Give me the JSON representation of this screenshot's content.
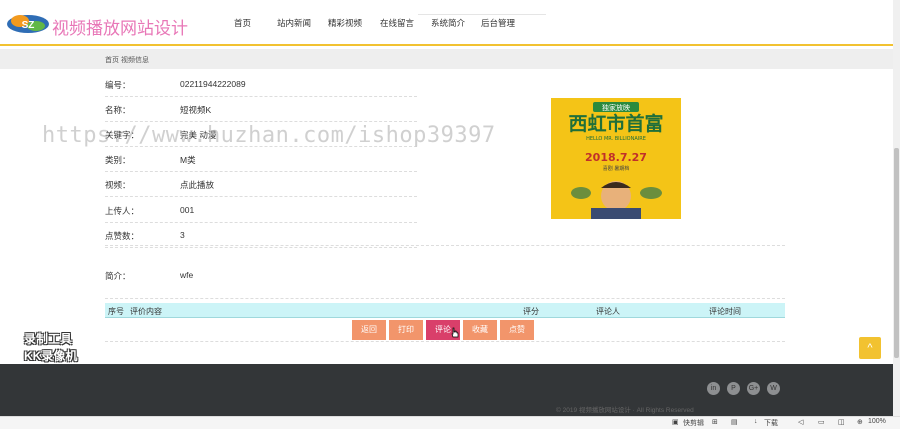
{
  "header": {
    "site_title": "视频播放网站设计",
    "nav": [
      "首页",
      "站内新闻",
      "精彩视频",
      "在线留言",
      "系统简介",
      "后台管理"
    ]
  },
  "breadcrumb": "首页 视频信息",
  "video": {
    "fields": [
      {
        "label": "编号：",
        "value": "02211944222089"
      },
      {
        "label": "名称：",
        "value": "短视频K"
      },
      {
        "label": "关键字：",
        "value": "完美 动漫"
      },
      {
        "label": "类别：",
        "value": "M类"
      },
      {
        "label": "视频：",
        "value": "点此播放"
      },
      {
        "label": "上传人：",
        "value": "001"
      },
      {
        "label": "点赞数：",
        "value": "3"
      }
    ],
    "intro_label": "简介：",
    "intro_value": "wfe",
    "poster": {
      "badge": "独家放映",
      "title": "西虹市首富",
      "subtitle": "HELLO MR. BILLIONAIRE",
      "date": "2018.7.27",
      "tagline": "喜剧 暑期档"
    }
  },
  "comments": {
    "headers": [
      "序号",
      "评价内容",
      "评分",
      "评论人",
      "评论时间"
    ]
  },
  "actions": [
    "返回",
    "打印",
    "评论",
    "收藏",
    "点赞"
  ],
  "footer": {
    "social": [
      "in",
      "P",
      "G+",
      "W"
    ],
    "copyright": "© 2019 视频播放网站设计 · All Rights Reserved"
  },
  "watermark": "https://www.huzhan.com/ishop39397",
  "recorder": {
    "line1": "录制工具",
    "line2": "KK录像机"
  },
  "to_top": "^",
  "statusbar": {
    "left": "快剪辑",
    "download": "下载",
    "zoom": "100%"
  },
  "colors": {
    "accent": "#f2c230",
    "title_pink": "#e877b7",
    "button": "#f2956b",
    "button_active": "#d93f6a"
  }
}
